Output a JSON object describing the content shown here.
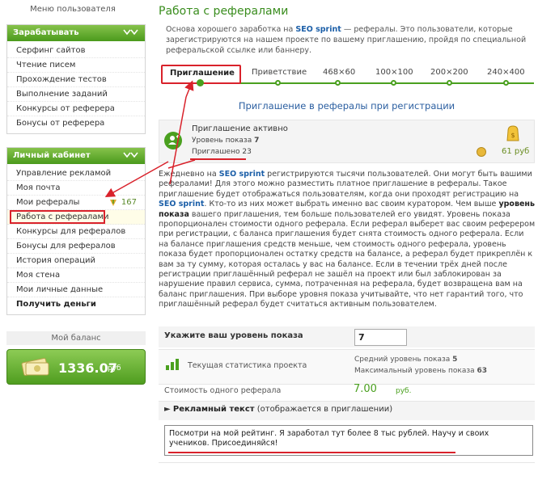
{
  "sidebar": {
    "menu_title": "Меню пользователя",
    "earn_section": {
      "title": "Зарабатывать",
      "items": [
        "Серфинг сайтов",
        "Чтение писем",
        "Прохождение тестов",
        "Выполнение заданий",
        "Конкурсы от реферера",
        "Бонусы от реферера"
      ]
    },
    "cabinet_section": {
      "title": "Личный кабинет",
      "items": [
        {
          "label": "Управление рекламой"
        },
        {
          "label": "Моя почта"
        },
        {
          "label": "Мои рефералы",
          "count": "167"
        },
        {
          "label": "Работа с рефералами"
        },
        {
          "label": "Конкурсы для рефералов"
        },
        {
          "label": "Бонусы для рефералов"
        },
        {
          "label": "История операций"
        },
        {
          "label": "Моя стена"
        },
        {
          "label": "Мои личные данные"
        },
        {
          "label": "Получить деньги"
        }
      ]
    },
    "balance": {
      "title": "Мой баланс",
      "value": "1336.07",
      "currency": "руб"
    }
  },
  "main": {
    "title": "Работа с рефералами",
    "intro_prefix": "Основа хорошего заработка на ",
    "intro_brand": "SEO sprint",
    "intro_suffix": " — рефералы. Это пользователи, которые зарегистрируются на нашем проекте по вашему приглашению, пройдя по специальной реферальской ссылке или баннеру.",
    "tabs": [
      "Приглашение",
      "Приветствие",
      "468×60",
      "100×100",
      "200×200",
      "240×400"
    ],
    "active_tab": "Приглашение",
    "invitation_title": "Приглашение в рефералы при регистрации",
    "status": {
      "active": "Приглашение активно",
      "level_label": "Уровень показа",
      "level_value": "7",
      "invited_label": "Приглашено",
      "invited_value": "23",
      "price": "61 руб"
    },
    "description": {
      "p1": "Ежедневно на ",
      "brand": "SEO sprint",
      "p2": " регистрируются тысячи пользователей. Они могут быть вашими рефералами! Для этого можно разместить платное приглашение в рефералы. Такое приглашение будет отображаться пользователям, когда они проходят регистрацию на ",
      "brand2": "SEO sprint",
      "p3": ". Кто-то из них может выбрать именно вас своим куратором. Чем выше ",
      "bold1": "уровень показа",
      "p4": " вашего приглашения, тем больше пользователей его увидят. Уровень показа пропорционален стоимости одного реферала. Если реферал выберет вас своим реферером при регистрации, с баланса приглашения будет снята стоимость одного реферала. Если на балансе приглашения средств меньше, чем стоимость одного реферала, уровень показа будет пропорционален остатку средств на балансе, а реферал будет прикреплён к вам за ту сумму, которая осталась у вас на балансе. Если в течении трёх дней после регистрации приглашённый реферал не зашёл на проект или был заблокирован за нарушение правил сервиса, сумма, потраченная на реферала, будет возвращена вам на баланс приглашения. При выборе уровня показа учитывайте, что нет гарантий того, что приглашённый реферал будет считаться активным пользователем."
    },
    "level": {
      "label": "Укажите ваш уровень показа",
      "value": "7"
    },
    "stats": {
      "label": "Текущая статистика проекта",
      "avg_label": "Средний уровень показа",
      "avg_value": "5",
      "max_label": "Максимальный уровень показа",
      "max_value": "63"
    },
    "cost": {
      "label": "Стоимость одного реферала",
      "value": "7.00",
      "currency": "руб."
    },
    "ad": {
      "label_bold": "Рекламный текст",
      "label_rest": " (отображается в приглашении)",
      "text": "Посмотри на мой рейтинг. Я заработал тут более 8 тыс рублей. Научу и своих учеников. Присоединяйся!"
    }
  },
  "colors": {
    "accent_green": "#4aa01f",
    "annotation_red": "#d9222b",
    "link_blue": "#1c5fa8"
  },
  "icons": [
    "chevron-down-icon",
    "add-user-icon",
    "coin-icon",
    "gear-icon",
    "bar-chart-icon",
    "money-icon",
    "reward-icon"
  ]
}
